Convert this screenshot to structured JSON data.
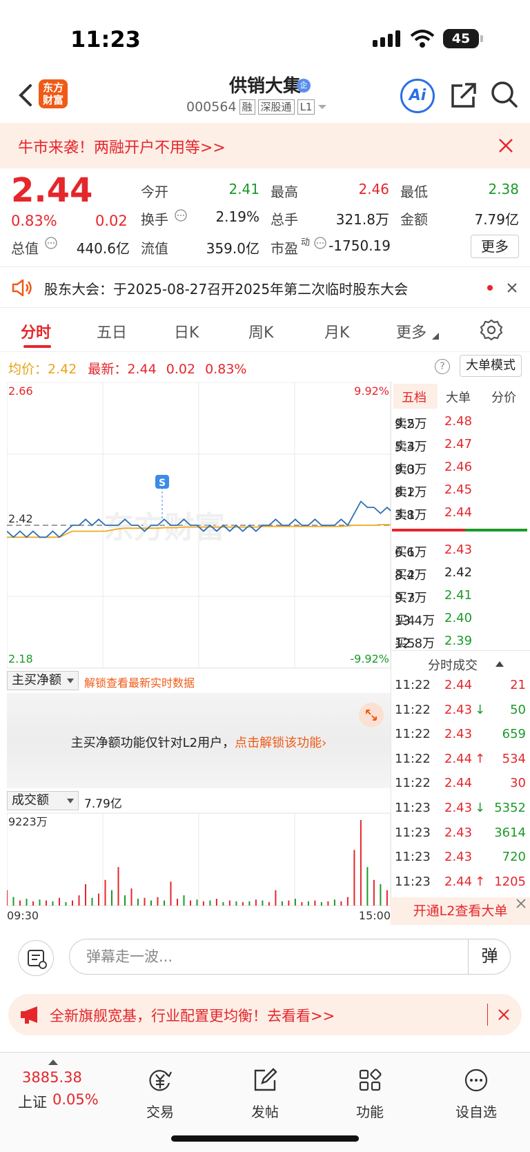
{
  "status": {
    "time": "11:23",
    "battery": "45"
  },
  "header": {
    "logo_line1": "东方",
    "logo_line2": "财富",
    "stock_name": "供销大集",
    "badge": "企",
    "code": "000564",
    "tags": [
      "融",
      "深股通",
      "L1"
    ],
    "ai_label": "Ai"
  },
  "banner": {
    "text": "牛市来袭！两融开户不用等>>"
  },
  "quote": {
    "price": "2.44",
    "change_pct": "0.83%",
    "change": "0.02",
    "fields": [
      {
        "label": "今开",
        "value": "2.41",
        "color": "green"
      },
      {
        "label": "最高",
        "value": "2.46",
        "color": "red"
      },
      {
        "label": "最低",
        "value": "2.38",
        "color": "green"
      },
      {
        "label": "换手",
        "value": "2.19%",
        "color": "dark"
      },
      {
        "label": "总手",
        "value": "321.8万",
        "color": "dark"
      },
      {
        "label": "金额",
        "value": "7.79亿",
        "color": "dark"
      },
      {
        "label": "总值",
        "value": "440.6亿",
        "color": "dark"
      },
      {
        "label": "流值",
        "value": "359.0亿",
        "color": "dark"
      },
      {
        "label": "市盈",
        "value": "-1750.19",
        "color": "dark"
      }
    ],
    "pe_sup": "动",
    "more_label": "更多"
  },
  "notice": {
    "text": "股东大会：于2025-08-27召开2025年第二次临时股东大会"
  },
  "tabs": [
    "分时",
    "五日",
    "日K",
    "周K",
    "月K",
    "更多"
  ],
  "avg_row": {
    "avg_label": "均价：",
    "avg_value": "2.42",
    "latest_label": "最新：",
    "latest_value": "2.44",
    "change": "0.02",
    "change_pct": "0.83%",
    "big_mode": "大单模式"
  },
  "chart": {
    "top_price": "2.66",
    "bottom_price": "2.18",
    "top_pct": "9.92%",
    "bottom_pct": "-9.92%",
    "ref_price": "2.42",
    "signal": "S",
    "watermark": "东方财富",
    "start_time": "09:30",
    "end_time": "15:00",
    "volume_max": "9223万"
  },
  "chart_data": {
    "type": "line",
    "ylim": [
      2.18,
      2.66
    ],
    "reference": 2.42,
    "price": [
      2.41,
      2.4,
      2.41,
      2.4,
      2.41,
      2.4,
      2.4,
      2.41,
      2.4,
      2.41,
      2.42,
      2.42,
      2.43,
      2.42,
      2.43,
      2.42,
      2.42,
      2.42,
      2.43,
      2.42,
      2.42,
      2.41,
      2.42,
      2.42,
      2.43,
      2.42,
      2.42,
      2.43,
      2.42,
      2.42,
      2.41,
      2.42,
      2.41,
      2.42,
      2.41,
      2.42,
      2.41,
      2.42,
      2.41,
      2.42,
      2.42,
      2.43,
      2.42,
      2.42,
      2.43,
      2.42,
      2.42,
      2.43,
      2.42,
      2.42,
      2.42,
      2.43,
      2.42,
      2.44,
      2.46,
      2.45,
      2.45,
      2.44,
      2.45,
      2.44,
      2.43,
      2.44
    ],
    "avg": [
      2.4,
      2.4,
      2.4,
      2.4,
      2.4,
      2.4,
      2.4,
      2.4,
      2.4,
      2.405,
      2.41,
      2.41,
      2.41,
      2.41,
      2.41,
      2.41,
      2.412,
      2.414,
      2.415,
      2.415,
      2.415,
      2.415,
      2.415,
      2.415,
      2.416,
      2.416,
      2.416,
      2.417,
      2.417,
      2.417,
      2.417,
      2.417,
      2.417,
      2.417,
      2.417,
      2.417,
      2.417,
      2.417,
      2.417,
      2.418,
      2.418,
      2.418,
      2.418,
      2.418,
      2.418,
      2.418,
      2.418,
      2.418,
      2.418,
      2.418,
      2.418,
      2.418,
      2.419,
      2.42,
      2.42,
      2.42,
      2.42,
      2.421,
      2.421,
      2.421,
      2.421,
      2.421
    ],
    "volume": [
      18,
      10,
      6,
      8,
      5,
      7,
      6,
      5,
      9,
      4,
      6,
      12,
      25,
      9,
      14,
      30,
      18,
      45,
      12,
      20,
      8,
      9,
      6,
      10,
      6,
      28,
      8,
      12,
      6,
      7,
      5,
      6,
      8,
      4,
      6,
      5,
      4,
      5,
      7,
      6,
      4,
      18,
      5,
      6,
      8,
      4,
      5,
      6,
      4,
      5,
      7,
      5,
      10,
      65,
      100,
      45,
      30,
      25,
      18,
      12,
      15,
      8
    ],
    "volume_up": [
      true,
      false,
      true,
      false,
      true,
      false,
      true,
      false,
      true,
      false,
      true,
      true,
      true,
      false,
      true,
      true,
      false,
      true,
      false,
      true,
      false,
      true,
      false,
      true,
      false,
      true,
      true,
      false,
      true,
      false,
      true,
      false,
      true,
      false,
      true,
      false,
      true,
      false,
      true,
      false,
      true,
      true,
      false,
      true,
      false,
      true,
      false,
      true,
      false,
      true,
      false,
      true,
      true,
      true,
      true,
      false,
      true,
      false,
      true,
      false,
      true,
      false
    ]
  },
  "order_book": {
    "tabs": [
      "五档",
      "大单",
      "分价"
    ],
    "asks": [
      {
        "label": "卖5",
        "price": "2.48",
        "vol": "9.2万",
        "color": "red"
      },
      {
        "label": "卖4",
        "price": "2.47",
        "vol": "5.3万",
        "color": "red"
      },
      {
        "label": "卖3",
        "price": "2.46",
        "vol": "9.0万",
        "color": "red"
      },
      {
        "label": "卖2",
        "price": "2.45",
        "vol": "8.1万",
        "color": "red"
      },
      {
        "label": "卖1",
        "price": "2.44",
        "vol": "3.8万",
        "color": "red"
      }
    ],
    "bids": [
      {
        "label": "买1",
        "price": "2.43",
        "vol": "6.6万",
        "color": "red"
      },
      {
        "label": "买2",
        "price": "2.42",
        "vol": "8.4万",
        "color": "dark"
      },
      {
        "label": "买3",
        "price": "2.41",
        "vol": "9.7万",
        "color": "green"
      },
      {
        "label": "买4",
        "price": "2.40",
        "vol": "13.4万",
        "color": "green"
      },
      {
        "label": "买5",
        "price": "2.39",
        "vol": "12.8万",
        "color": "green"
      }
    ]
  },
  "ticks": {
    "title": "分时成交",
    "rows": [
      {
        "time": "11:22",
        "price": "2.44",
        "arrow": "",
        "vol": "21",
        "vcolor": "red"
      },
      {
        "time": "11:22",
        "price": "2.43",
        "arrow": "↓",
        "vol": "50",
        "vcolor": "green"
      },
      {
        "time": "11:22",
        "price": "2.43",
        "arrow": "",
        "vol": "659",
        "vcolor": "green"
      },
      {
        "time": "11:22",
        "price": "2.44",
        "arrow": "↑",
        "vol": "534",
        "vcolor": "red"
      },
      {
        "time": "11:22",
        "price": "2.44",
        "arrow": "",
        "vol": "30",
        "vcolor": "red"
      },
      {
        "time": "11:23",
        "price": "2.43",
        "arrow": "↓",
        "vol": "5352",
        "vcolor": "green"
      },
      {
        "time": "11:23",
        "price": "2.43",
        "arrow": "",
        "vol": "3614",
        "vcolor": "green"
      },
      {
        "time": "11:23",
        "price": "2.43",
        "arrow": "",
        "vol": "720",
        "vcolor": "green"
      },
      {
        "time": "11:23",
        "price": "2.44",
        "arrow": "↑",
        "vol": "1205",
        "vcolor": "red"
      }
    ],
    "l2_button": "开通L2查看大单"
  },
  "main_buy": {
    "selector": "主买净额",
    "unlock_link": "解锁查看最新实时数据",
    "panel_text": "主买净额功能仅针对L2用户，",
    "panel_link": "点击解锁该功能"
  },
  "amount": {
    "selector": "成交额",
    "value": "7.79亿"
  },
  "comment": {
    "placeholder": "弹幕走一波...",
    "danmu": "弹"
  },
  "promo": {
    "text": "全新旗舰宽基，行业配置更均衡！去看看>>"
  },
  "bottom_nav": {
    "index_value": "3885.38",
    "index_name": "上证",
    "index_pct": "0.05%",
    "items": [
      "交易",
      "发帖",
      "功能",
      "设自选"
    ]
  }
}
